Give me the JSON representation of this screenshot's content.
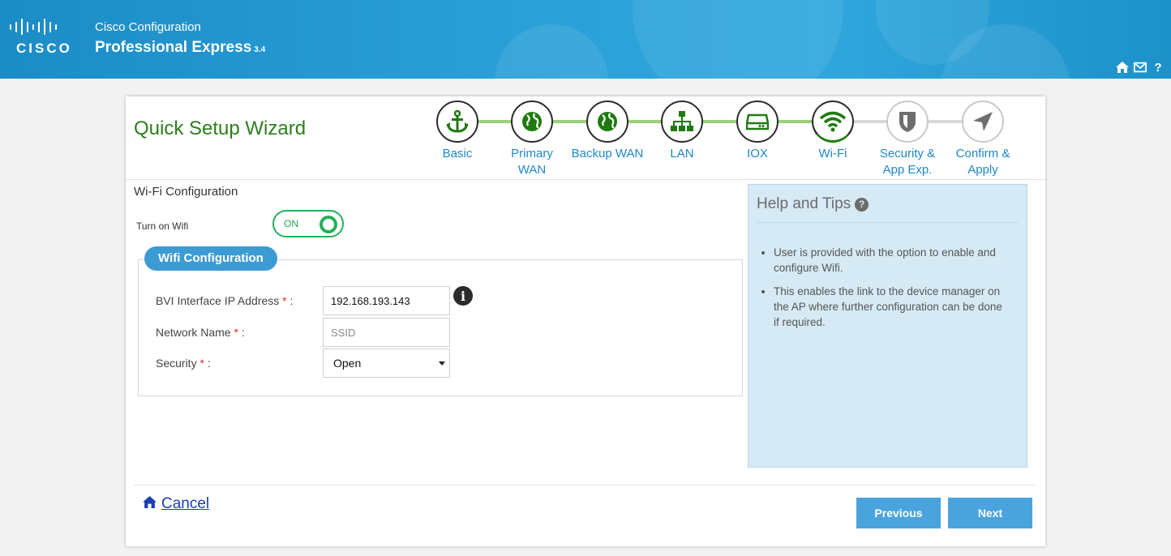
{
  "app": {
    "vendor": "CISCO",
    "product_line1": "Cisco Configuration",
    "product_line2": "Professional Express",
    "version": "3.4"
  },
  "header_icons": [
    "home-icon",
    "mail-icon",
    "help-icon"
  ],
  "wizard": {
    "title": "Quick Setup Wizard",
    "steps": [
      {
        "label": "Basic",
        "icon": "anchor-icon",
        "state": "done"
      },
      {
        "label": "Primary WAN",
        "icon": "globe-icon",
        "state": "done"
      },
      {
        "label": "Backup WAN",
        "icon": "globe-icon",
        "state": "done"
      },
      {
        "label": "LAN",
        "icon": "network-icon",
        "state": "done"
      },
      {
        "label": "IOX",
        "icon": "drive-icon",
        "state": "done"
      },
      {
        "label": "Wi-Fi",
        "icon": "wifi-icon",
        "state": "current"
      },
      {
        "label": "Security & App Exp.",
        "icon": "shield-icon",
        "state": "pending"
      },
      {
        "label": "Confirm & Apply",
        "icon": "send-icon",
        "state": "pending"
      }
    ]
  },
  "wifi": {
    "section_title": "Wi-Fi Configuration",
    "turn_on_label": "Turn on Wifi",
    "toggle_state": "ON",
    "fieldset_title": "Wifi Configuration",
    "bvi_label": "BVI Interface IP Address",
    "bvi_value": "192.168.193.143",
    "network_label": "Network Name",
    "network_placeholder": "SSID",
    "security_label": "Security",
    "security_value": "Open",
    "required_mark": "*",
    "label_suffix": ":"
  },
  "help": {
    "title": "Help and Tips",
    "tips": [
      "User is provided with the option to enable and configure Wifi.",
      "This enables the link to the device manager on the AP where further configuration can be done if required."
    ]
  },
  "footer": {
    "cancel_label": "Cancel",
    "previous_label": "Previous",
    "next_label": "Next"
  },
  "colors": {
    "header": "#2ba0d8",
    "title_green": "#2e7d1e",
    "step_done_line": "#9dd07a",
    "step_pending_line": "#d9d9d9",
    "toggle_green": "#23b05a",
    "button_blue": "#4aa3dc",
    "help_bg": "#d6eaf5"
  }
}
